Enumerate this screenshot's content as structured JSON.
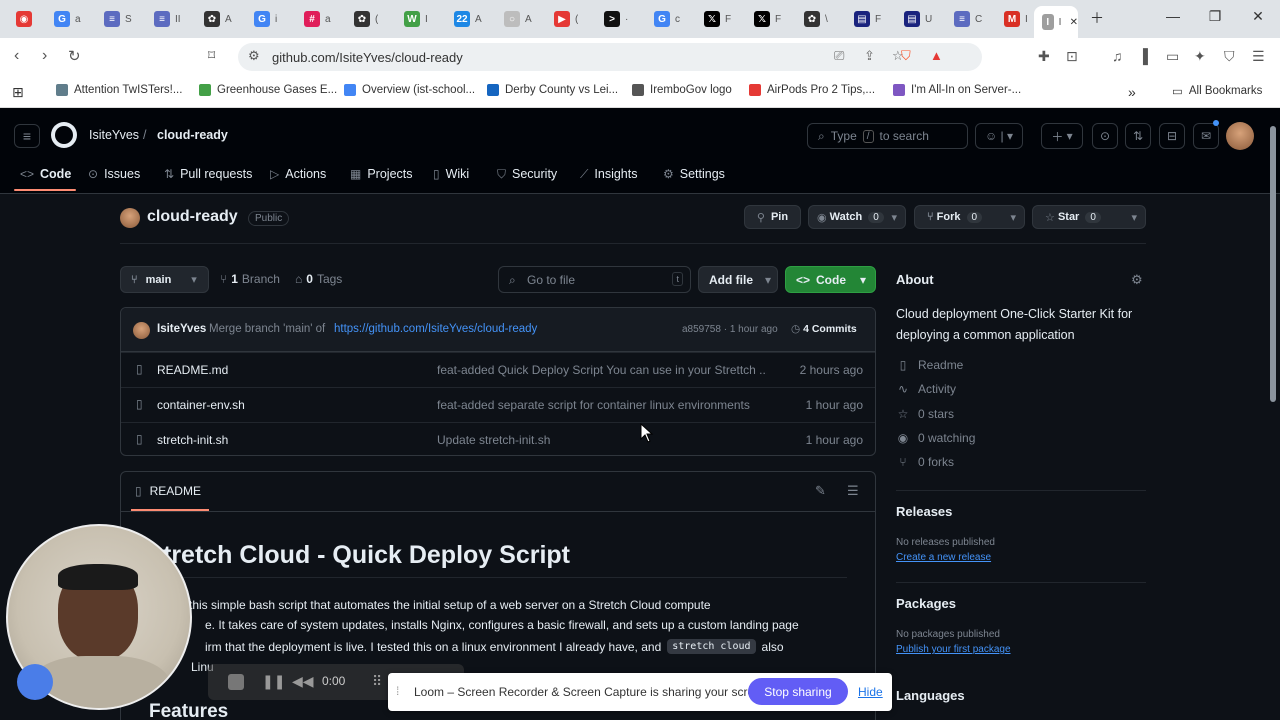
{
  "browser": {
    "tabs": [
      {
        "icon": "record-icon",
        "color": "#e53935",
        "glyph": "◉"
      },
      {
        "icon": "google-icon",
        "color": "#4285f4",
        "glyph": "G",
        "label": "a"
      },
      {
        "icon": "docs-icon",
        "color": "#5c6bc0",
        "glyph": "≡",
        "label": "S"
      },
      {
        "icon": "docs-icon",
        "color": "#5c6bc0",
        "glyph": "≡",
        "label": "II"
      },
      {
        "icon": "openai-icon",
        "color": "#333333",
        "glyph": "✿",
        "label": "A"
      },
      {
        "icon": "google-icon",
        "color": "#4285f4",
        "glyph": "G",
        "label": "i"
      },
      {
        "icon": "slack-icon",
        "color": "#e01e5a",
        "glyph": "#",
        "label": "a"
      },
      {
        "icon": "openai-icon",
        "color": "#333333",
        "glyph": "✿",
        "label": "("
      },
      {
        "icon": "word-icon",
        "color": "#43a047",
        "glyph": "W",
        "label": "I"
      },
      {
        "icon": "calendar-icon",
        "color": "#1e88e5",
        "glyph": "22",
        "label": "A"
      },
      {
        "icon": "generic-icon",
        "color": "#bdbdbd",
        "glyph": "○",
        "label": "A"
      },
      {
        "icon": "youtube-icon",
        "color": "#e53935",
        "glyph": "▶",
        "label": "("
      },
      {
        "icon": "terminal-icon",
        "color": "#111111",
        "glyph": ">",
        "label": "·"
      },
      {
        "icon": "google-icon",
        "color": "#4285f4",
        "glyph": "G",
        "label": "c"
      },
      {
        "icon": "x-icon",
        "color": "#000000",
        "glyph": "𝕏",
        "label": "F"
      },
      {
        "icon": "x-icon",
        "color": "#000000",
        "glyph": "𝕏",
        "label": "F"
      },
      {
        "icon": "openai-icon",
        "color": "#333333",
        "glyph": "✿",
        "label": "\\"
      },
      {
        "icon": "tech-icon",
        "color": "#1a237e",
        "glyph": "▤",
        "label": "F"
      },
      {
        "icon": "tech-icon",
        "color": "#1a237e",
        "glyph": "▤",
        "label": "U"
      },
      {
        "icon": "docs-icon",
        "color": "#5c6bc0",
        "glyph": "≡",
        "label": "C"
      },
      {
        "icon": "gmail-icon",
        "color": "#d93025",
        "glyph": "M",
        "label": "I"
      },
      {
        "icon": "page-icon",
        "color": "#9e9e9e",
        "glyph": "I",
        "label": "I"
      }
    ],
    "url": "github.com/IsiteYves/cloud-ready",
    "bookmarks": [
      {
        "label": "Attention TwISTers!...",
        "color": "#607d8b"
      },
      {
        "label": "Greenhouse Gases E...",
        "color": "#43a047"
      },
      {
        "label": "Overview (ist-school...",
        "color": "#4285f4"
      },
      {
        "label": "Derby County vs Lei...",
        "color": "#1565c0"
      },
      {
        "label": "IremboGov logo",
        "color": "#555555"
      },
      {
        "label": "AirPods Pro 2 Tips,...",
        "color": "#e53935"
      },
      {
        "label": "I'm All-In on Server-...",
        "color": "#7e57c2"
      }
    ],
    "all_bookmarks": "All Bookmarks"
  },
  "header": {
    "owner": "IsiteYves",
    "sep": "/",
    "repo": "cloud-ready",
    "search_pre": "Type",
    "search_key": "/",
    "search_post": "to search"
  },
  "nav": [
    {
      "label": "Code",
      "icon": "code-icon",
      "glyph": "<>"
    },
    {
      "label": "Issues",
      "icon": "issue-icon",
      "glyph": "⊙"
    },
    {
      "label": "Pull requests",
      "icon": "pull-request-icon",
      "glyph": "⇅"
    },
    {
      "label": "Actions",
      "icon": "actions-icon",
      "glyph": "▷"
    },
    {
      "label": "Projects",
      "icon": "projects-icon",
      "glyph": "▦"
    },
    {
      "label": "Wiki",
      "icon": "wiki-icon",
      "glyph": "▯"
    },
    {
      "label": "Security",
      "icon": "shield-icon",
      "glyph": "⛉"
    },
    {
      "label": "Insights",
      "icon": "graph-icon",
      "glyph": "⟋"
    },
    {
      "label": "Settings",
      "icon": "gear-icon",
      "glyph": "⚙"
    }
  ],
  "repo": {
    "name": "cloud-ready",
    "visibility": "Public",
    "pin": "Pin",
    "watch": "Watch",
    "watch_count": "0",
    "fork": "Fork",
    "fork_count": "0",
    "star": "Star",
    "star_count": "0"
  },
  "branchbar": {
    "branch": "main",
    "branches_count": "1",
    "branches_label": "Branch",
    "tags_count": "0",
    "tags_label": "Tags",
    "goto_placeholder": "Go to file",
    "goto_key": "t",
    "add_file": "Add file",
    "code": "Code"
  },
  "commit": {
    "author": "IsiteYves",
    "message_prefix": "Merge branch 'main' of",
    "message_link": "https://github.com/IsiteYves/cloud-ready",
    "hash_time": "a859758 · 1 hour ago",
    "commits": "4 Commits"
  },
  "files": [
    {
      "name": "README.md",
      "message": "feat-added Quick Deploy Script You can use in your Strettch ...",
      "time": "2 hours ago"
    },
    {
      "name": "container-env.sh",
      "message": "feat-added separate script for container linux environments",
      "time": "1 hour ago"
    },
    {
      "name": "stretch-init.sh",
      "message": "Update stretch-init.sh",
      "time": "1 hour ago"
    }
  ],
  "readme": {
    "tab": "README",
    "title": "Stretch Cloud - Quick Deploy Script",
    "title_visible": "tretch Cloud - Quick Deploy Script",
    "line1": "d this simple bash script that automates the initial setup of a web server on a Stretch Cloud compute",
    "line2": "e. It takes care of system updates, installs Nginx, configures a basic firewall, and sets up a custom landing page",
    "line3a": "irm that the deployment is live. I tested this on a linux environment I already have, and",
    "line3_code": "stretch cloud",
    "line3b": "also",
    "line4": "Linu",
    "features": "Features"
  },
  "about": {
    "title": "About",
    "description": "Cloud deployment One-Click Starter Kit for deploying a common application",
    "items": [
      {
        "label": "Readme",
        "icon": "book-icon",
        "glyph": "▯"
      },
      {
        "label": "Activity",
        "icon": "pulse-icon",
        "glyph": "∿"
      },
      {
        "label": "0 stars",
        "icon": "star-icon",
        "glyph": "☆"
      },
      {
        "label": "0 watching",
        "icon": "eye-icon",
        "glyph": "◉"
      },
      {
        "label": "0 forks",
        "icon": "fork-icon",
        "glyph": "⑂"
      }
    ],
    "releases_title": "Releases",
    "releases_text": "No releases published",
    "releases_link": "Create a new release",
    "packages_title": "Packages",
    "packages_text": "No packages published",
    "packages_link": "Publish your first package",
    "languages_title": "Languages"
  },
  "loom": {
    "message": "Loom – Screen Recorder & Screen Capture is sharing your screen.",
    "stop": "Stop sharing",
    "hide": "Hide",
    "timer": "0:00"
  },
  "colors": {
    "bg": "#0d1117",
    "accent_green": "#238636",
    "link": "#4493f8",
    "loom_purple": "#625df5"
  }
}
